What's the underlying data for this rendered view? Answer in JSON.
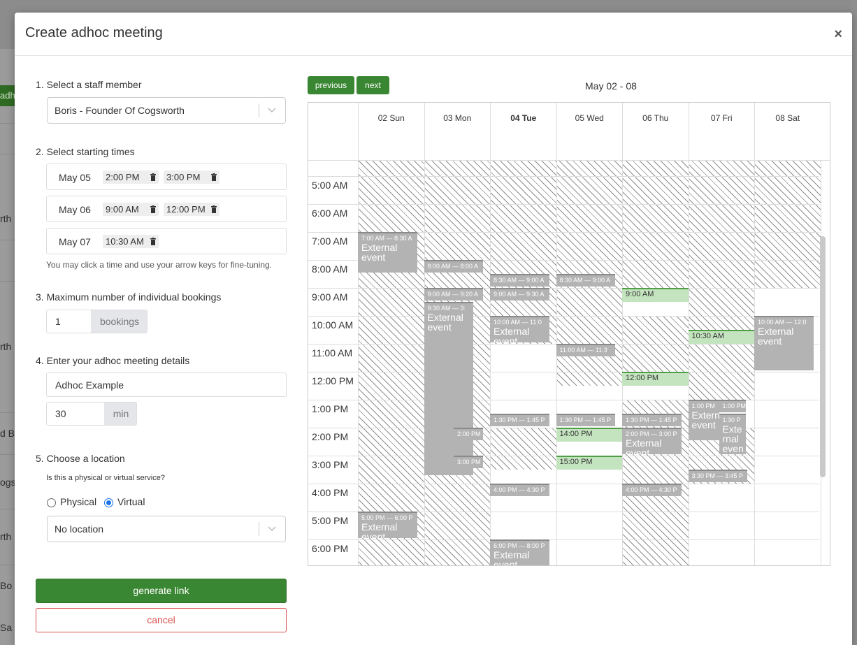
{
  "background": {
    "left_button": "adh",
    "left_texts": [
      "rth",
      "rth",
      "d B",
      "ogs",
      "rth",
      "Bo",
      "Sa"
    ]
  },
  "modal": {
    "title": "Create adhoc meeting",
    "close_label": "×"
  },
  "steps": {
    "staff_label": "1. Select a staff member",
    "staff_value": "Boris - Founder Of Cogsworth",
    "times_label": "2. Select starting times",
    "times": [
      {
        "date": "May 05",
        "slots": [
          "2:00 PM",
          "3:00 PM"
        ]
      },
      {
        "date": "May 06",
        "slots": [
          "9:00 AM",
          "12:00 PM"
        ]
      },
      {
        "date": "May 07",
        "slots": [
          "10:30 AM"
        ]
      }
    ],
    "times_hint": "You may click a time and use your arrow keys for fine-tuning.",
    "bookings_label": "3. Maximum number of individual bookings",
    "bookings_value": "1",
    "bookings_unit": "bookings",
    "details_label": "4. Enter your adhoc meeting details",
    "meeting_name": "Adhoc Example",
    "duration_value": "30",
    "duration_unit": "min",
    "location_label": "5. Choose a location",
    "location_question": "Is this a physical or virtual service?",
    "physical_label": "Physical",
    "virtual_label": "Virtual",
    "selected_mode": "Virtual",
    "location_value": "No location",
    "generate_label": "generate link",
    "cancel_label": "cancel"
  },
  "calendar": {
    "previous_label": "previous",
    "next_label": "next",
    "range": "May 02 - 08",
    "days": [
      "02 Sun",
      "03 Mon",
      "04 Tue",
      "05 Wed",
      "06 Thu",
      "07 Fri",
      "08 Sat"
    ],
    "today_index": 2,
    "hours": [
      "5:00 AM",
      "6:00 AM",
      "7:00 AM",
      "8:00 AM",
      "9:00 AM",
      "10:00 AM",
      "11:00 AM",
      "12:00 PM",
      "1:00 PM",
      "2:00 PM",
      "3:00 PM",
      "4:00 PM",
      "5:00 PM",
      "6:00 PM"
    ],
    "events": [
      {
        "day": 0,
        "start": 7.0,
        "end": 8.5,
        "time": "7:00 AM — 8:30 A",
        "name": "External event"
      },
      {
        "day": 0,
        "start": 17.0,
        "end": 18.0,
        "time": "5:00 PM — 6:00 P",
        "name": "External event"
      },
      {
        "day": 1,
        "start": 8.0,
        "end": 8.5,
        "time": "8:00 AM — 8:00 A",
        "name": ""
      },
      {
        "day": 1,
        "start": 9.0,
        "end": 9.5,
        "time": "9:00 AM — 9:20 A",
        "name": ""
      },
      {
        "day": 1,
        "start": 9.5,
        "end": 15.75,
        "time": "9:30 AM — 3:",
        "name": "External event",
        "narrow": true
      },
      {
        "day": 1,
        "start": 14.0,
        "end": 14.5,
        "time": "2:00 PM",
        "name": "",
        "sub": true
      },
      {
        "day": 1,
        "start": 15.0,
        "end": 15.5,
        "time": "3:00 PM",
        "name": "",
        "sub": true
      },
      {
        "day": 2,
        "start": 8.5,
        "end": 9.0,
        "time": "8:30 AM — 9:00 A",
        "name": ""
      },
      {
        "day": 2,
        "start": 9.0,
        "end": 9.5,
        "time": "9:00 AM — 9:30 A",
        "name": ""
      },
      {
        "day": 2,
        "start": 10.0,
        "end": 11.0,
        "time": "10:00 AM — 11:0",
        "name": "External event"
      },
      {
        "day": 2,
        "start": 13.5,
        "end": 14.0,
        "time": "1:30 PM — 1:45 P",
        "name": ""
      },
      {
        "day": 2,
        "start": 16.0,
        "end": 16.5,
        "time": "4:00 PM — 4:30 P",
        "name": ""
      },
      {
        "day": 2,
        "start": 18.0,
        "end": 20.0,
        "time": "6:00 PM — 8:00 P",
        "name": "External event"
      },
      {
        "day": 3,
        "start": 8.5,
        "end": 9.0,
        "time": "8:30 AM — 9:00 A",
        "name": ""
      },
      {
        "day": 3,
        "start": 11.0,
        "end": 11.5,
        "time": "11:00 AM — 11:3",
        "name": ""
      },
      {
        "day": 3,
        "start": 13.5,
        "end": 14.0,
        "time": "1:30 PM — 1:45 P",
        "name": ""
      },
      {
        "day": 4,
        "start": 13.5,
        "end": 14.0,
        "time": "1:30 PM — 1:45 P",
        "name": ""
      },
      {
        "day": 4,
        "start": 14.0,
        "end": 15.0,
        "time": "2:00 PM — 3:00 P",
        "name": "External event"
      },
      {
        "day": 4,
        "start": 16.0,
        "end": 16.5,
        "time": "4:00 PM — 4:30 P",
        "name": ""
      },
      {
        "day": 5,
        "start": 13.0,
        "end": 14.5,
        "time": "1:00 PM",
        "name": "Extern event",
        "half": "left"
      },
      {
        "day": 5,
        "start": 13.0,
        "end": 13.5,
        "time": "1:00 PM",
        "name": "",
        "half": "right"
      },
      {
        "day": 5,
        "start": 13.5,
        "end": 15.0,
        "time": "1:30 P",
        "name": "Exte rnal even t",
        "half": "right"
      },
      {
        "day": 5,
        "start": 15.5,
        "end": 16.0,
        "time": "3:30 PM — 3:45 P",
        "name": ""
      },
      {
        "day": 6,
        "start": 10.0,
        "end": 12.0,
        "time": "10:00 AM — 12:0",
        "name": "External event"
      }
    ],
    "slots": [
      {
        "day": 3,
        "start": 14.0,
        "label": "14:00 PM"
      },
      {
        "day": 3,
        "start": 15.0,
        "label": "15:00 PM"
      },
      {
        "day": 4,
        "start": 9.0,
        "label": "9:00 AM"
      },
      {
        "day": 4,
        "start": 12.0,
        "label": "12:00 PM"
      },
      {
        "day": 5,
        "start": 10.5,
        "label": "10:30 AM"
      }
    ]
  }
}
